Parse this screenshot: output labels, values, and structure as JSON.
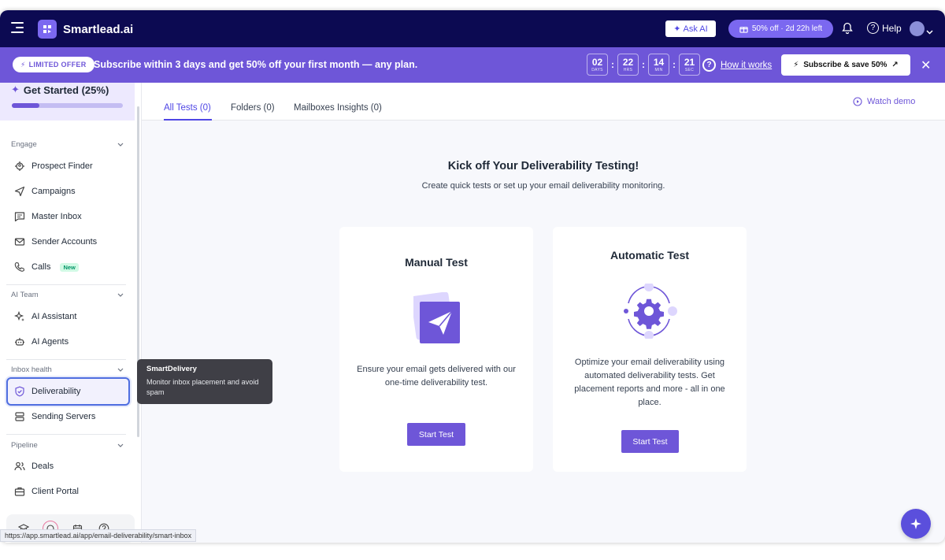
{
  "app": {
    "name": "Smartlead.ai"
  },
  "topbar": {
    "ask_ai": "Ask AI",
    "promo_pill": "50% off · 2d 22h left",
    "help": "Help"
  },
  "offer": {
    "badge": "LIMITED OFFER",
    "text": "Subscribe within 3 days and get 50% off your first month — any plan.",
    "countdown": [
      {
        "value": "02",
        "unit": "DAYS"
      },
      {
        "value": "22",
        "unit": "HRS"
      },
      {
        "value": "14",
        "unit": "MIN"
      },
      {
        "value": "21",
        "unit": "SEC"
      }
    ],
    "how_it_works": "How it works",
    "subscribe": "Subscribe & save 50%"
  },
  "sidebar": {
    "get_started": "Get Started (25%)",
    "get_started_progress": 0.25,
    "sections": {
      "engage": "Engage",
      "ai_team": "AI Team",
      "inbox_health": "Inbox health",
      "pipeline": "Pipeline"
    },
    "items": {
      "prospect_finder": "Prospect Finder",
      "campaigns": "Campaigns",
      "master_inbox": "Master Inbox",
      "sender_accounts": "Sender Accounts",
      "calls": "Calls",
      "calls_badge": "New",
      "ai_assistant": "AI Assistant",
      "ai_agents": "AI Agents",
      "deliverability": "Deliverability",
      "sending_servers": "Sending Servers",
      "deals": "Deals",
      "client_portal": "Client Portal"
    }
  },
  "tooltip": {
    "title": "SmartDelivery",
    "text": "Monitor inbox placement and avoid spam"
  },
  "main": {
    "tabs": [
      "All Tests (0)",
      "Folders (0)",
      "Mailboxes Insights (0)"
    ],
    "watch_demo": "Watch demo",
    "hero_title": "Kick off Your Deliverability Testing!",
    "hero_subtitle": "Create quick tests or set up your email deliverability monitoring.",
    "manual": {
      "title": "Manual Test",
      "desc": "Ensure your email gets delivered with our one-time deliverability test.",
      "button": "Start Test"
    },
    "automatic": {
      "title": "Automatic Test",
      "desc": "Optimize your email deliverability using automated deliverability tests. Get placement reports and more - all in one place.",
      "button": "Start Test"
    }
  },
  "status_url": "https://app.smartlead.ai/app/email-deliverability/smart-inbox",
  "colors": {
    "brand_dark": "#0c0a52",
    "accent": "#6e56d8",
    "active_tab": "#4f46e5"
  }
}
